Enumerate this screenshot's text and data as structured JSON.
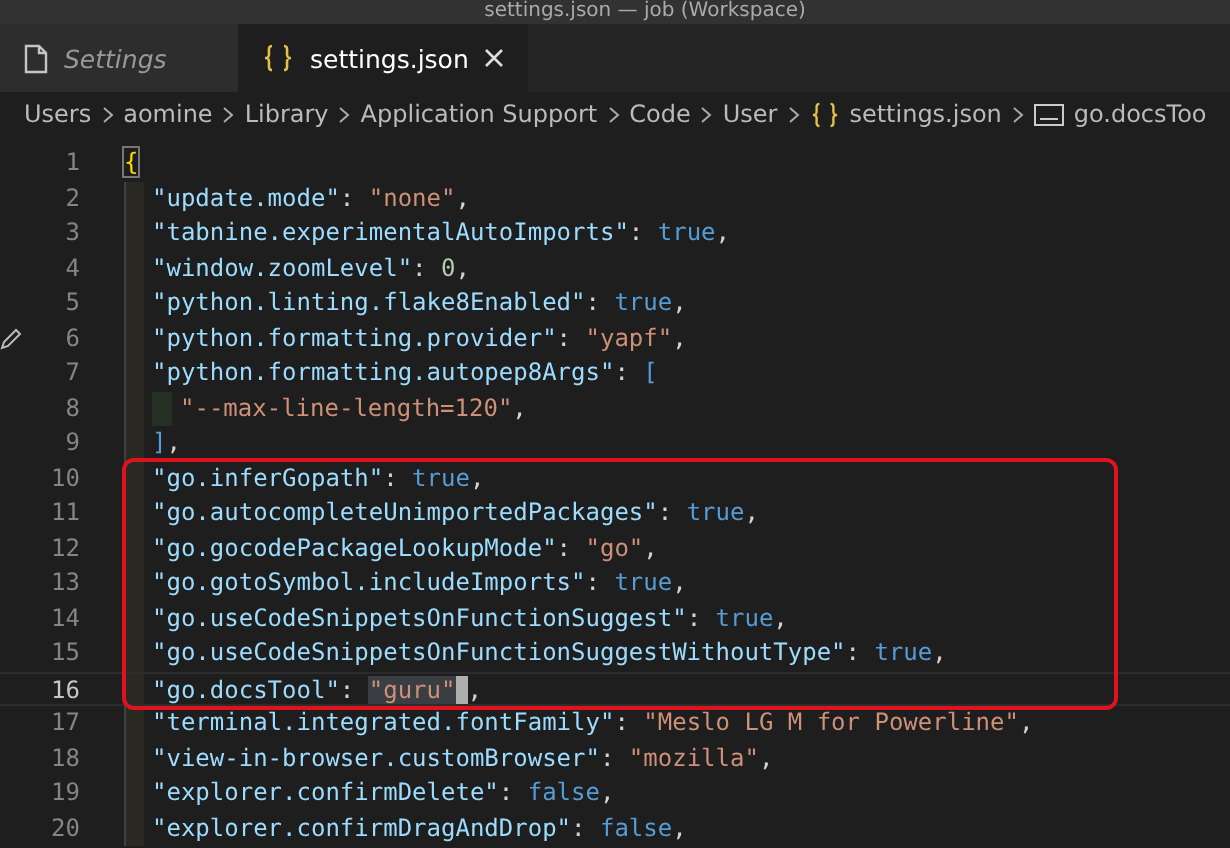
{
  "window": {
    "title": "settings.json — job (Workspace)"
  },
  "tabs": [
    {
      "label": "Settings",
      "kind": "settings-editor",
      "selected": false
    },
    {
      "label": "settings.json",
      "kind": "json-file",
      "selected": true
    }
  ],
  "breadcrumb": [
    {
      "label": "Users",
      "kind": "folder"
    },
    {
      "label": "aomine",
      "kind": "folder"
    },
    {
      "label": "Library",
      "kind": "folder"
    },
    {
      "label": "Application Support",
      "kind": "folder"
    },
    {
      "label": "Code",
      "kind": "folder"
    },
    {
      "label": "User",
      "kind": "folder"
    },
    {
      "label": "settings.json",
      "kind": "json-file"
    },
    {
      "label": "go.docsToo",
      "kind": "string-property"
    }
  ],
  "editor": {
    "blocks": [
      {
        "boxed": false,
        "lines": [
          {
            "number": "1",
            "nested": false,
            "current": false,
            "edited": false,
            "tokens": [
              {
                "kind": "bracket",
                "text": "{"
              }
            ]
          },
          {
            "number": "2",
            "nested": false,
            "current": false,
            "edited": false,
            "tokens": [
              {
                "kind": "key",
                "text": "\"update.mode\""
              },
              {
                "kind": "punct",
                "text": ": "
              },
              {
                "kind": "string",
                "text": "\"none\""
              },
              {
                "kind": "punct",
                "text": ","
              }
            ]
          },
          {
            "number": "3",
            "nested": false,
            "current": false,
            "edited": false,
            "tokens": [
              {
                "kind": "key",
                "text": "\"tabnine.experimentalAutoImports\""
              },
              {
                "kind": "punct",
                "text": ": "
              },
              {
                "kind": "bool",
                "text": "true"
              },
              {
                "kind": "punct",
                "text": ","
              }
            ]
          },
          {
            "number": "4",
            "nested": false,
            "current": false,
            "edited": false,
            "tokens": [
              {
                "kind": "key",
                "text": "\"window.zoomLevel\""
              },
              {
                "kind": "punct",
                "text": ": "
              },
              {
                "kind": "number",
                "text": "0"
              },
              {
                "kind": "punct",
                "text": ","
              }
            ]
          },
          {
            "number": "5",
            "nested": false,
            "current": false,
            "edited": false,
            "tokens": [
              {
                "kind": "key",
                "text": "\"python.linting.flake8Enabled\""
              },
              {
                "kind": "punct",
                "text": ": "
              },
              {
                "kind": "bool",
                "text": "true"
              },
              {
                "kind": "punct",
                "text": ","
              }
            ]
          },
          {
            "number": "6",
            "nested": false,
            "current": false,
            "edited": true,
            "tokens": [
              {
                "kind": "key",
                "text": "\"python.formatting.provider\""
              },
              {
                "kind": "punct",
                "text": ": "
              },
              {
                "kind": "string",
                "text": "\"yapf\""
              },
              {
                "kind": "punct",
                "text": ","
              }
            ]
          },
          {
            "number": "7",
            "nested": false,
            "current": false,
            "edited": false,
            "tokens": [
              {
                "kind": "key",
                "text": "\"python.formatting.autopep8Args\""
              },
              {
                "kind": "punct",
                "text": ": "
              },
              {
                "kind": "bool",
                "text": "["
              }
            ]
          },
          {
            "number": "8",
            "nested": true,
            "current": false,
            "edited": false,
            "tokens": [
              {
                "kind": "string",
                "text": "\"--max-line-length=120\""
              },
              {
                "kind": "punct",
                "text": ","
              }
            ]
          },
          {
            "number": "9",
            "nested": false,
            "current": false,
            "edited": false,
            "tokens": [
              {
                "kind": "bool",
                "text": "]"
              },
              {
                "kind": "punct",
                "text": ","
              }
            ]
          }
        ]
      },
      {
        "boxed": true,
        "lines": [
          {
            "number": "10",
            "nested": false,
            "current": false,
            "edited": false,
            "tokens": [
              {
                "kind": "key",
                "text": "\"go.inferGopath\""
              },
              {
                "kind": "punct",
                "text": ": "
              },
              {
                "kind": "bool",
                "text": "true"
              },
              {
                "kind": "punct",
                "text": ","
              }
            ]
          },
          {
            "number": "11",
            "nested": false,
            "current": false,
            "edited": false,
            "tokens": [
              {
                "kind": "key",
                "text": "\"go.autocompleteUnimportedPackages\""
              },
              {
                "kind": "punct",
                "text": ": "
              },
              {
                "kind": "bool",
                "text": "true"
              },
              {
                "kind": "punct",
                "text": ","
              }
            ]
          },
          {
            "number": "12",
            "nested": false,
            "current": false,
            "edited": false,
            "tokens": [
              {
                "kind": "key",
                "text": "\"go.gocodePackageLookupMode\""
              },
              {
                "kind": "punct",
                "text": ": "
              },
              {
                "kind": "string",
                "text": "\"go\""
              },
              {
                "kind": "punct",
                "text": ","
              }
            ]
          },
          {
            "number": "13",
            "nested": false,
            "current": false,
            "edited": false,
            "tokens": [
              {
                "kind": "key",
                "text": "\"go.gotoSymbol.includeImports\""
              },
              {
                "kind": "punct",
                "text": ": "
              },
              {
                "kind": "bool",
                "text": "true"
              },
              {
                "kind": "punct",
                "text": ","
              }
            ]
          },
          {
            "number": "14",
            "nested": false,
            "current": false,
            "edited": false,
            "tokens": [
              {
                "kind": "key",
                "text": "\"go.useCodeSnippetsOnFunctionSuggest\""
              },
              {
                "kind": "punct",
                "text": ": "
              },
              {
                "kind": "bool",
                "text": "true"
              },
              {
                "kind": "punct",
                "text": ","
              }
            ]
          },
          {
            "number": "15",
            "nested": false,
            "current": false,
            "edited": false,
            "tokens": [
              {
                "kind": "key",
                "text": "\"go.useCodeSnippetsOnFunctionSuggestWithoutType\""
              },
              {
                "kind": "punct",
                "text": ": "
              },
              {
                "kind": "bool",
                "text": "true"
              },
              {
                "kind": "punct",
                "text": ","
              }
            ]
          },
          {
            "number": "16",
            "nested": false,
            "current": true,
            "edited": false,
            "tokens": [
              {
                "kind": "key",
                "text": "\"go.docsTool\""
              },
              {
                "kind": "punct",
                "text": ": "
              },
              {
                "kind": "selected-string",
                "text": "\"guru\""
              },
              {
                "kind": "punct",
                "text": ","
              }
            ]
          }
        ]
      },
      {
        "boxed": false,
        "lines": [
          {
            "number": "17",
            "nested": false,
            "current": false,
            "edited": false,
            "tokens": [
              {
                "kind": "key",
                "text": "\"terminal.integrated.fontFamily\""
              },
              {
                "kind": "punct",
                "text": ": "
              },
              {
                "kind": "string",
                "text": "\"Meslo LG M for Powerline\""
              },
              {
                "kind": "punct",
                "text": ","
              }
            ]
          },
          {
            "number": "18",
            "nested": false,
            "current": false,
            "edited": false,
            "tokens": [
              {
                "kind": "key",
                "text": "\"view-in-browser.customBrowser\""
              },
              {
                "kind": "punct",
                "text": ": "
              },
              {
                "kind": "string",
                "text": "\"mozilla\""
              },
              {
                "kind": "punct",
                "text": ","
              }
            ]
          },
          {
            "number": "19",
            "nested": false,
            "current": false,
            "edited": false,
            "tokens": [
              {
                "kind": "key",
                "text": "\"explorer.confirmDelete\""
              },
              {
                "kind": "punct",
                "text": ": "
              },
              {
                "kind": "bool",
                "text": "false"
              },
              {
                "kind": "punct",
                "text": ","
              }
            ]
          },
          {
            "number": "20",
            "nested": false,
            "current": false,
            "edited": false,
            "tokens": [
              {
                "kind": "key",
                "text": "\"explorer.confirmDragAndDrop\""
              },
              {
                "kind": "punct",
                "text": ": "
              },
              {
                "kind": "bool",
                "text": "false"
              },
              {
                "kind": "punct",
                "text": ","
              }
            ]
          }
        ]
      }
    ]
  }
}
